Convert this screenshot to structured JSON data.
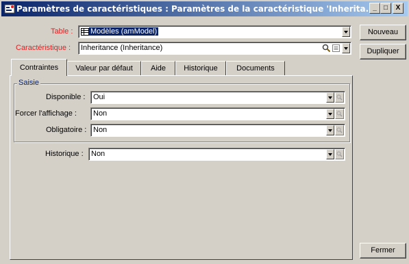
{
  "window": {
    "title": "Paramètres de caractéristiques : Paramètres de la caractéristique 'Inherita...",
    "minimize": "_",
    "maximize": "□",
    "close": "X"
  },
  "form": {
    "table_label": "Table :",
    "table_value": "Modèles (amModel)",
    "caracteristique_label": "Caractéristique :",
    "caracteristique_value": "Inheritance (Inheritance)"
  },
  "tabs": [
    {
      "label": "Contraintes",
      "active": true
    },
    {
      "label": "Valeur par défaut",
      "active": false
    },
    {
      "label": "Aide",
      "active": false
    },
    {
      "label": "Historique",
      "active": false
    },
    {
      "label": "Documents",
      "active": false
    }
  ],
  "saisie": {
    "group_title": "Saisie",
    "disponible_label": "Disponible :",
    "disponible_value": "Oui",
    "forcer_label": "Forcer l'affichage :",
    "forcer_value": "Non",
    "obligatoire_label": "Obligatoire :",
    "obligatoire_value": "Non"
  },
  "historique": {
    "label": "Historique :",
    "value": "Non"
  },
  "buttons": {
    "nouveau": "Nouveau",
    "dupliquer": "Dupliquer",
    "fermer": "Fermer"
  },
  "colors": {
    "title_gradient_start": "#0a246a",
    "title_gradient_end": "#a6caf0",
    "required_label": "#e31e1e",
    "window_face": "#d4d0c8"
  }
}
